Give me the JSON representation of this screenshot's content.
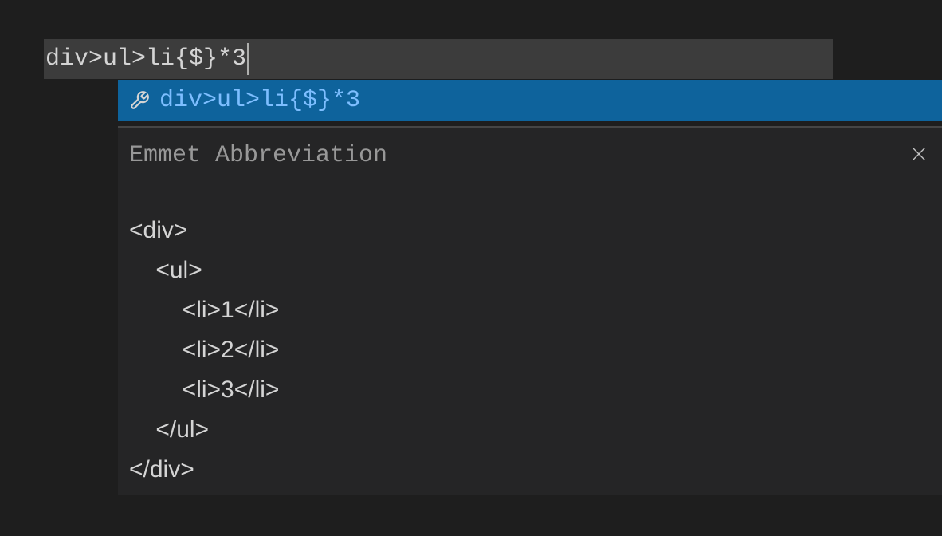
{
  "editor": {
    "input_text": "div>ul>li{$}*3"
  },
  "suggestion": {
    "text": "div>ul>li{$}*3",
    "icon_name": "wrench"
  },
  "documentation": {
    "title": "Emmet Abbreviation",
    "expansion_lines": [
      "<div>",
      "    <ul>",
      "        <li>1</li>",
      "        <li>2</li>",
      "        <li>3</li>",
      "    </ul>",
      "</div>"
    ]
  }
}
